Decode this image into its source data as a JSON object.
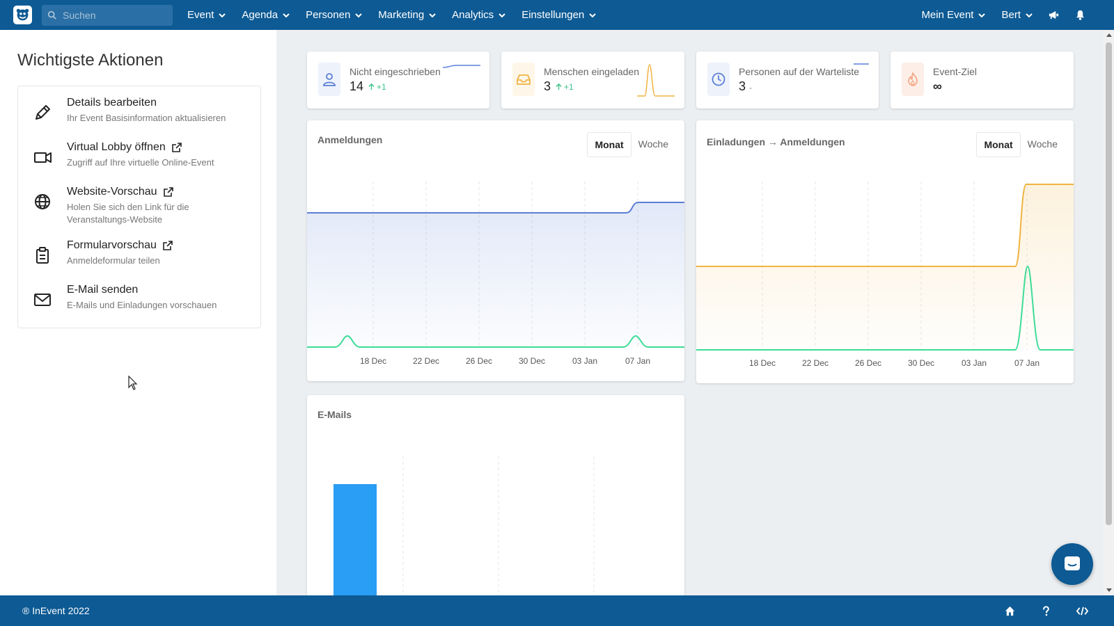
{
  "topbar": {
    "search_placeholder": "Suchen",
    "nav": [
      "Event",
      "Agenda",
      "Personen",
      "Marketing",
      "Analytics",
      "Einstellungen"
    ],
    "right": {
      "event": "Mein Event",
      "user": "Bert"
    }
  },
  "sidebar": {
    "title": "Wichtigste Aktionen",
    "actions": [
      {
        "title": "Details bearbeiten",
        "subtitle": "Ihr Event Basisinformation aktualisieren",
        "icon": "pencil-icon",
        "external": false
      },
      {
        "title": "Virtual Lobby öffnen",
        "subtitle": "Zugriff auf Ihre virtuelle Online-Event",
        "icon": "video-camera-icon",
        "external": true
      },
      {
        "title": "Website-Vorschau",
        "subtitle": "Holen Sie sich den Link für die Veranstaltungs-Website",
        "icon": "globe-icon",
        "external": true
      },
      {
        "title": "Formularvorschau",
        "subtitle": "Anmeldeformular teilen",
        "icon": "clipboard-icon",
        "external": true
      },
      {
        "title": "E-Mail senden",
        "subtitle": "E-Mails und Einladungen vorschauen",
        "icon": "envelope-icon",
        "external": false
      }
    ]
  },
  "stats": [
    {
      "label": "Nicht eingeschrieben",
      "value": "14",
      "delta": "+1",
      "icon": "user-icon",
      "color": "#5b7fd6"
    },
    {
      "label": "Menschen eingeladen",
      "value": "3",
      "delta": "+1",
      "icon": "inbox-icon",
      "color": "#f0b341"
    },
    {
      "label": "Personen auf der Warteliste",
      "value": "3",
      "dash": "-",
      "icon": "clock-icon",
      "color": "#5b7fd6"
    },
    {
      "label": "Event-Ziel",
      "value": "∞",
      "icon": "fire-icon",
      "color": "#f4a582"
    }
  ],
  "charts": {
    "registrations": {
      "title": "Anmeldungen",
      "toggle": [
        "Monat",
        "Woche"
      ],
      "active": "Monat"
    },
    "conversion": {
      "title": "Einladungen → Anmeldungen",
      "toggle": [
        "Monat",
        "Woche"
      ],
      "active": "Monat"
    },
    "emails": {
      "title": "E-Mails"
    }
  },
  "chart_data": [
    {
      "type": "area",
      "title": "Anmeldungen",
      "x": [
        "18 Dec",
        "22 Dec",
        "26 Dec",
        "30 Dec",
        "03 Jan",
        "07 Jan"
      ],
      "series": [
        {
          "color": "#5b7fd6",
          "values": [
            13,
            13,
            13,
            13,
            13,
            14
          ]
        },
        {
          "color": "#3ddc97",
          "values": [
            0,
            0,
            0,
            0,
            0,
            1
          ]
        }
      ]
    },
    {
      "type": "area",
      "title": "Einladungen → Anmeldungen",
      "x": [
        "18 Dec",
        "22 Dec",
        "26 Dec",
        "30 Dec",
        "03 Jan",
        "07 Jan"
      ],
      "series": [
        {
          "color": "#f0b341",
          "values": [
            2,
            2,
            2,
            2,
            2,
            3
          ]
        },
        {
          "color": "#3ddc97",
          "values": [
            0,
            0,
            0,
            0,
            0,
            1
          ]
        }
      ]
    },
    {
      "type": "bar",
      "title": "E-Mails",
      "series": [
        {
          "color": "#2a9df4",
          "values": [
            1
          ]
        }
      ]
    }
  ],
  "footer": {
    "copyright": "® InEvent 2022"
  }
}
